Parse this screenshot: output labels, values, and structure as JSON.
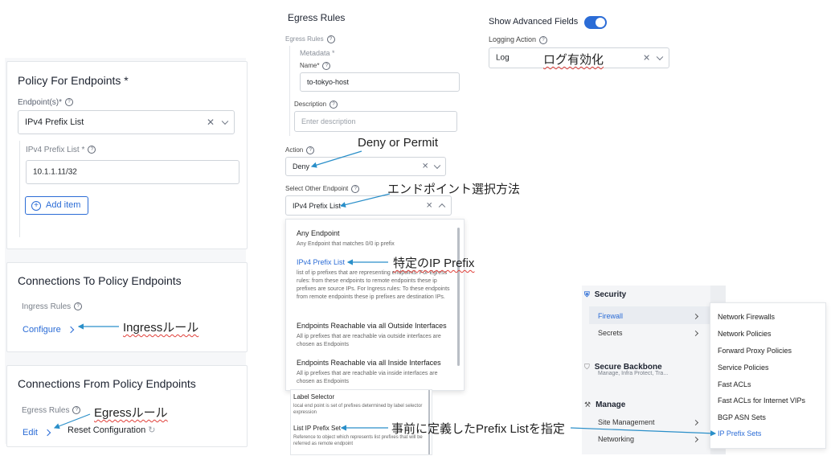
{
  "left": {
    "policy": {
      "title": "Policy For Endpoints *",
      "endpoints_label": "Endpoint(s)*",
      "endpoints_value": "IPv4 Prefix List",
      "prefix_list_label": "IPv4 Prefix List *",
      "prefix_value": "10.1.1.11/32",
      "add_item": "Add item"
    },
    "connections_to": {
      "title": "Connections To Policy Endpoints",
      "ingress_label": "Ingress Rules",
      "configure": "Configure",
      "annotation": "Ingressルール"
    },
    "connections_from": {
      "title": "Connections From Policy Endpoints",
      "egress_label": "Egress Rules",
      "edit": "Edit",
      "reset": "Reset Configuration",
      "annotation": "Egressルール"
    }
  },
  "egress": {
    "title": "Egress Rules",
    "egress_rules_label": "Egress Rules",
    "metadata": "Metadata *",
    "name_label": "Name*",
    "name_value": "to-tokyo-host",
    "description_label": "Description",
    "description_placeholder": "Enter description",
    "action_label": "Action",
    "action_value": "Deny",
    "action_annotation": "Deny or Permit",
    "select_other_label": "Select Other Endpoint",
    "select_other_value": "IPv4 Prefix List",
    "select_other_annotation": "エンドポイント選択方法",
    "dropdown": [
      {
        "title": "Any Endpoint",
        "desc": "Any Endpoint that matches 0/0 ip prefix",
        "selected": false
      },
      {
        "title": "IPv4 Prefix List",
        "desc": "list of ip prefixes that are representing endpoints. For Egress rules: from these endpoints to remote endpoints these ip prefixes are source IPs. For Ingress rules: To these endpoints from remote endpoints these ip prefixes are destination IPs.",
        "selected": true
      },
      {
        "title": "Endpoints Reachable via all Outside Interfaces",
        "desc": "All ip prefixes that are reachable via outside interfaces are chosen as Endpoints",
        "selected": false
      },
      {
        "title": "Endpoints Reachable via all Inside Interfaces",
        "desc": "All ip prefixes that are reachable via inside interfaces are chosen as Endpoints",
        "selected": false
      }
    ],
    "ipv4_annotation": "特定のIP Prefix",
    "dropdown2": [
      {
        "title": "Label Selector",
        "desc": "local end point is set of prefixes determined by label selector expression"
      },
      {
        "title": "List IP Prefix Set",
        "desc": "Reference to object which represents list prefixes that will be referred as remote endpoint"
      }
    ],
    "prefix_set_annotation": "事前に定義したPrefix Listを指定"
  },
  "advanced": {
    "show_advanced": "Show Advanced Fields",
    "toggle_on": true,
    "logging_label": "Logging Action",
    "logging_value": "Log",
    "logging_annotation": "ログ有効化"
  },
  "nav": {
    "security": "Security",
    "firewall": "Firewall",
    "secrets": "Secrets",
    "secure_backbone": "Secure Backbone",
    "secure_backbone_sub": "Manage, Infra Protect, Tra...",
    "manage": "Manage",
    "site_management": "Site Management",
    "networking": "Networking",
    "submenu": [
      "Network Firewalls",
      "Network Policies",
      "Forward Proxy Policies",
      "Service Policies",
      "Fast ACLs",
      "Fast ACLs for Internet VIPs",
      "BGP ASN Sets",
      "IP Prefix Sets"
    ],
    "active_submenu": "IP Prefix Sets"
  },
  "colors": {
    "accent": "#2b6cd6",
    "arrow": "#2a8fc9",
    "wavy": "#e0403a"
  }
}
